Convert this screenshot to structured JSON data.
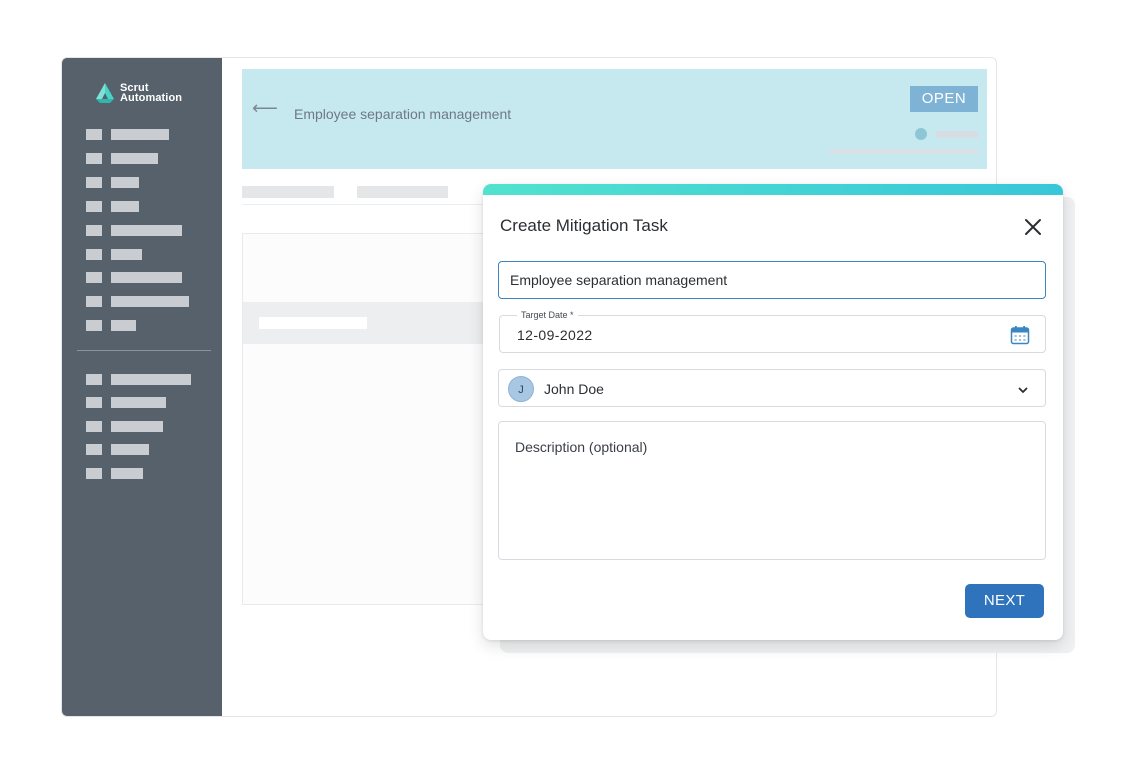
{
  "app": {
    "logo_line1": "Scrut",
    "logo_line2": "Automation"
  },
  "header": {
    "back_icon": "arrow-left-icon",
    "title": "Employee separation management",
    "status_badge": "OPEN"
  },
  "modal": {
    "title": "Create Mitigation Task",
    "close_icon": "close-icon",
    "task_name_value": "Employee separation management",
    "target_date_label": "Target Date *",
    "target_date_value": "12-09-2022",
    "calendar_icon": "calendar-icon",
    "assignee_initial": "J",
    "assignee_name": "John Doe",
    "dropdown_icon": "chevron-down-icon",
    "description_placeholder": "Description (optional)",
    "next_label": "NEXT"
  },
  "colors": {
    "sidebar": "#56616b",
    "header_banner": "#c6e9f0",
    "badge": "#7fb3d6",
    "accent": "#2f73bd",
    "modal_topbar": "#51e2cf"
  }
}
